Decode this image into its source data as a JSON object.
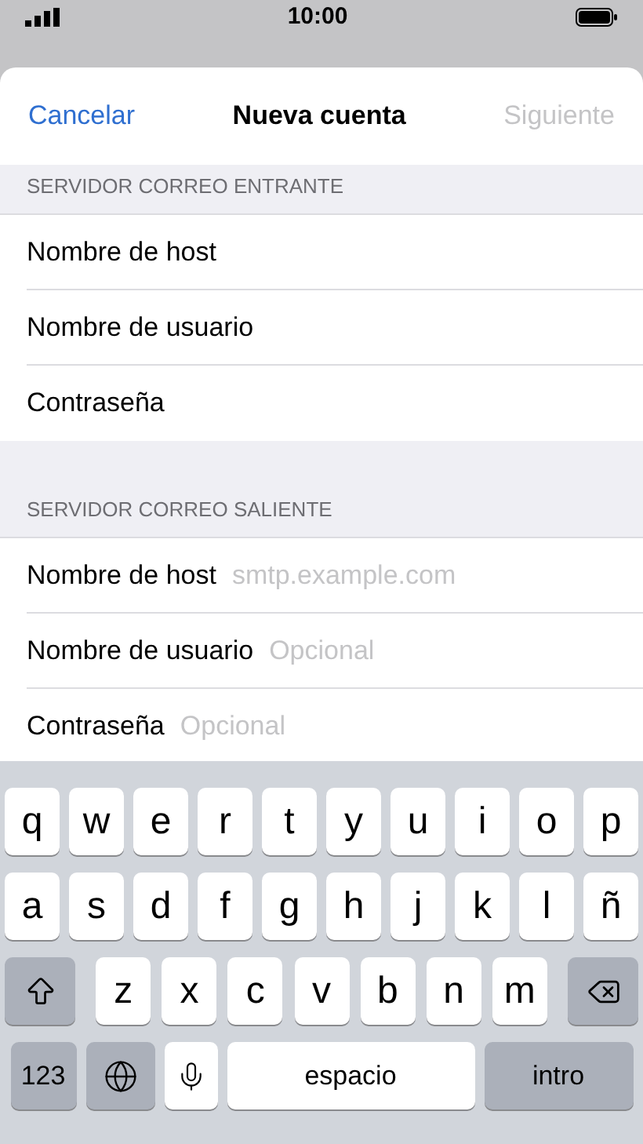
{
  "status_bar": {
    "time": "10:00"
  },
  "sheet_header": {
    "cancel": "Cancelar",
    "title": "Nueva cuenta",
    "next": "Siguiente",
    "next_disabled": true
  },
  "sections": [
    {
      "title": "SERVIDOR CORREO ENTRANTE",
      "fields": [
        {
          "label": "Nombre de host"
        },
        {
          "label": "Nombre de usuario"
        },
        {
          "label": "Contraseña"
        }
      ]
    },
    {
      "title": "SERVIDOR CORREO SALIENTE",
      "fields": [
        {
          "label": "Nombre de host",
          "placeholder": "smtp.example.com"
        },
        {
          "label": "Nombre de usuario",
          "placeholder": "Opcional"
        },
        {
          "label": "Contraseña",
          "placeholder": "Opcional"
        }
      ]
    }
  ],
  "keyboard": {
    "rows": [
      {
        "keys": [
          {
            "kind": "letter",
            "label": "q"
          },
          {
            "kind": "letter",
            "label": "w"
          },
          {
            "kind": "letter",
            "label": "e"
          },
          {
            "kind": "letter",
            "label": "r"
          },
          {
            "kind": "letter",
            "label": "t"
          },
          {
            "kind": "letter",
            "label": "y"
          },
          {
            "kind": "letter",
            "label": "u"
          },
          {
            "kind": "letter",
            "label": "i"
          },
          {
            "kind": "letter",
            "label": "o"
          },
          {
            "kind": "letter",
            "label": "p"
          }
        ]
      },
      {
        "keys": [
          {
            "kind": "letter",
            "label": "a"
          },
          {
            "kind": "letter",
            "label": "s"
          },
          {
            "kind": "letter",
            "label": "d"
          },
          {
            "kind": "letter",
            "label": "f"
          },
          {
            "kind": "letter",
            "label": "g"
          },
          {
            "kind": "letter",
            "label": "h"
          },
          {
            "kind": "letter",
            "label": "j"
          },
          {
            "kind": "letter",
            "label": "k"
          },
          {
            "kind": "letter",
            "label": "l"
          },
          {
            "kind": "letter",
            "label": "ñ"
          }
        ]
      },
      {
        "keys": [
          {
            "kind": "shift"
          },
          {
            "kind": "letter",
            "label": "z"
          },
          {
            "kind": "letter",
            "label": "x"
          },
          {
            "kind": "letter",
            "label": "c"
          },
          {
            "kind": "letter",
            "label": "v"
          },
          {
            "kind": "letter",
            "label": "b"
          },
          {
            "kind": "letter",
            "label": "n"
          },
          {
            "kind": "letter",
            "label": "m"
          },
          {
            "kind": "delete"
          }
        ]
      },
      {
        "keys": [
          {
            "kind": "mode",
            "label": "123"
          },
          {
            "kind": "globe"
          },
          {
            "kind": "mic"
          },
          {
            "kind": "space",
            "label": "espacio"
          },
          {
            "kind": "return",
            "label": "intro"
          }
        ]
      }
    ]
  }
}
